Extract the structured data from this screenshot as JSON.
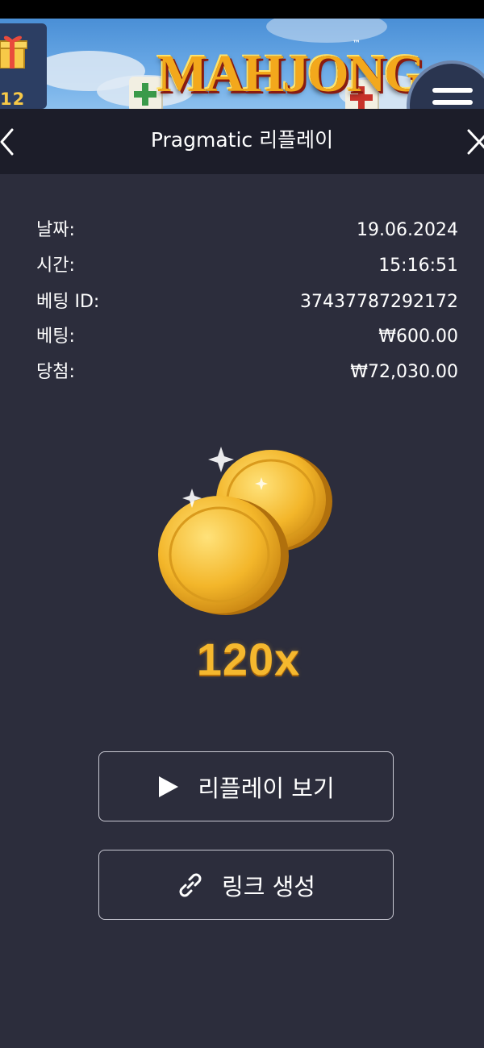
{
  "game": {
    "logo_text": "MAHJONG",
    "logo_tm": "™",
    "gift_count": "12"
  },
  "header": {
    "title": "Pragmatic 리플레이"
  },
  "info": [
    {
      "label": "날짜:",
      "value": "19.06.2024"
    },
    {
      "label": "시간:",
      "value": "15:16:51"
    },
    {
      "label": "베팅 ID:",
      "value": "37437787292172"
    },
    {
      "label": "베팅:",
      "value": "₩600.00"
    },
    {
      "label": "당첨:",
      "value": "₩72,030.00"
    }
  ],
  "result": {
    "multiplier": "120x"
  },
  "buttons": {
    "replay_label": "리플레이 보기",
    "link_label": "링크 생성"
  },
  "colors": {
    "background": "#2c2d3c",
    "header": "#1c1d29",
    "multiplier": "#f5b82e",
    "button_border": "#c9c9d3"
  },
  "icons": {
    "gift": "gift-icon",
    "prev": "chevron-left-icon",
    "close": "close-icon",
    "menu": "hamburger-menu-icon",
    "play": "play-icon",
    "link": "link-icon"
  }
}
